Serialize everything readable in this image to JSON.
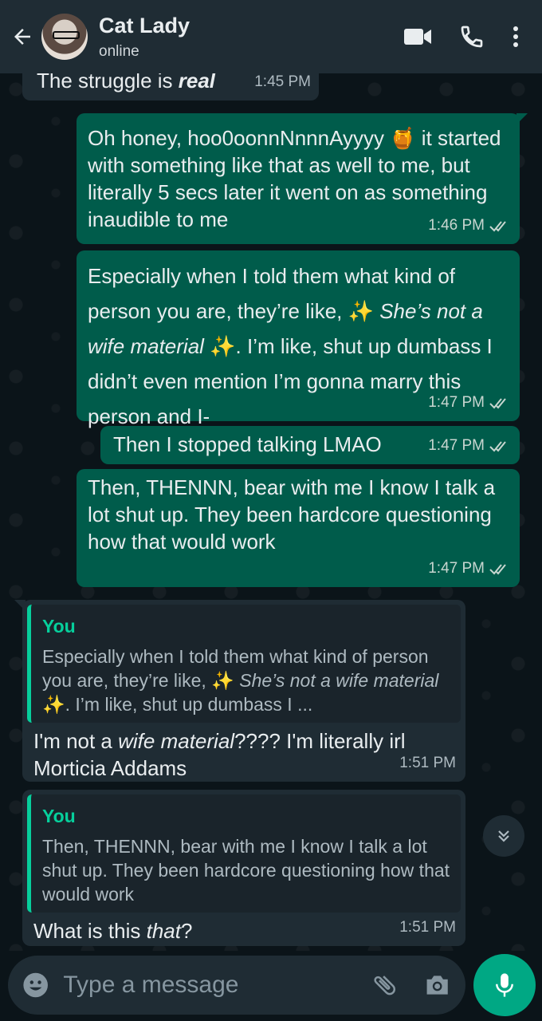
{
  "header": {
    "contact_name": "Cat Lady",
    "status": "online"
  },
  "messages": [
    {
      "id": "m0",
      "direction": "in",
      "text_before": "The struggle is ",
      "text_em": "real",
      "time": "1:45 PM"
    },
    {
      "id": "m1",
      "direction": "out",
      "text": "Oh honey, hoo0oonnNnnnAyyyy 🍯 it started with something like that as well to me, but literally 5 secs later it went on as something inaudible to me",
      "time": "1:46 PM"
    },
    {
      "id": "m2",
      "direction": "out",
      "text_a": "Especially when I told them what kind of person you are, they’re like, ✨ ",
      "text_em": "She’s not a wife material",
      "text_b": " ✨. I’m like, shut up dumbass I didn’t even mention I’m gonna marry this person and I-",
      "time": "1:47 PM"
    },
    {
      "id": "m3",
      "direction": "out",
      "text": "Then I stopped talking LMAO",
      "time": "1:47 PM"
    },
    {
      "id": "m4",
      "direction": "out",
      "text": "Then, THENNN, bear with me I know I talk a lot shut up. They been hardcore questioning how that would work",
      "time": "1:47 PM"
    },
    {
      "id": "m5",
      "direction": "in",
      "quote_author": "You",
      "quote_text_a": "Especially when I told them what kind of person you are, they’re like, ✨ ",
      "quote_text_em": "She’s not a wife material",
      "quote_text_b": " ✨. I’m like, shut up dumbass I ...",
      "text_a": "I'm not a ",
      "text_em": "wife material",
      "text_b": "???? I'm literally irl Morticia Addams",
      "time": "1:51 PM"
    },
    {
      "id": "m6",
      "direction": "in",
      "quote_author": "You",
      "quote_text": "Then, THENNN, bear with me I know I talk a lot shut up. They been hardcore questioning how that would work",
      "text_a": "What is this ",
      "text_em": "that",
      "text_b": "?",
      "time": "1:51 PM"
    }
  ],
  "composer": {
    "placeholder": "Type a message"
  },
  "colors": {
    "header_bg": "#1f2c34",
    "outgoing_bubble": "#005c4b",
    "incoming_bubble": "#1f2c34",
    "accent": "#00a884",
    "quote_accent": "#06cf9c",
    "read_ticks": "#c8d6d0"
  },
  "icons": {
    "back": "arrow-left-icon",
    "video_call": "video-camera-icon",
    "voice_call": "phone-icon",
    "menu": "kebab-menu-icon",
    "emoji": "emoji-icon",
    "attach": "paperclip-icon",
    "camera": "camera-icon",
    "mic": "microphone-icon",
    "scroll_down": "double-chevron-down-icon"
  }
}
